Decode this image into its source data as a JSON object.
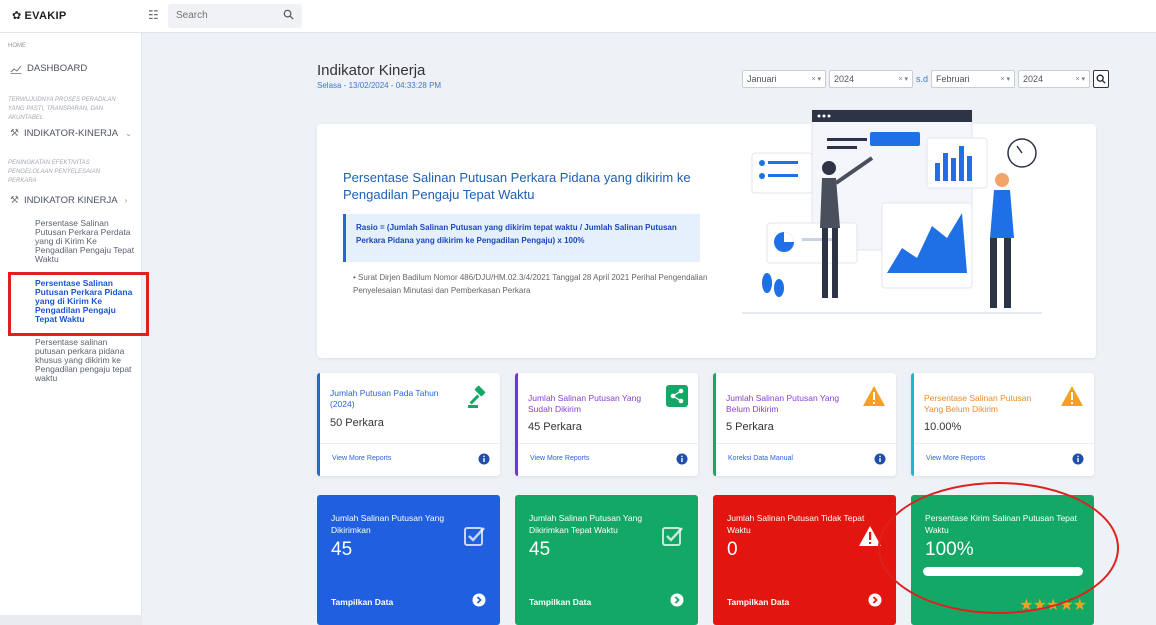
{
  "app": {
    "logo": "EVAKIP"
  },
  "search": {
    "placeholder": "Search"
  },
  "sidebar": {
    "home_label": "HOME",
    "dashboard": "DASHBOARD",
    "section1": "TERWUJUDNYA PROSES PERADILAN YANG PASTI, TRANSPARAN, DAN AKUNTABEL",
    "menu1": "INDIKATOR-KINERJA",
    "section2": "PENINGKATAN EFEKTIVITAS PENGELOLAAN PENYELESAIAN PERKARA",
    "menu2": "INDIKATOR KINERJA",
    "subitems": [
      "Persentase Salinan Putusan Perkara Perdata yang di Kirim Ke Pengadilan Pengaju Tepat Waktu",
      "Persentase Salinan Putusan Perkara Pidana yang di Kirim Ke Pengadilan Pengaju Tepat Waktu",
      "Persentase salinan putusan perkara pidana khusus yang dikirim ke Pengadilan pengaju tepat waktu"
    ]
  },
  "header": {
    "title": "Indikator Kinerja",
    "datetime": "Selasa - 13/02/2024 - 04:33:28 PM"
  },
  "filters": {
    "from_month": "Januari",
    "from_year": "2024",
    "separator": "s.d",
    "to_month": "Februari",
    "to_year": "2024"
  },
  "hero": {
    "title": "Persentase Salinan Putusan Perkara Pidana yang dikirim ke Pengadilan Pengaju Tepat Waktu",
    "ratio": "Rasio = (Jumlah Salinan Putusan yang dikirim tepat waktu / Jumlah Salinan Putusan Perkara Pidana yang dikirim ke Pengadilan Pengaju) x 100%",
    "note": "Surat Dirjen Badilum Nomor 486/DJU/HM.02.3/4/2021 Tanggal 28 April 2021 Perihal Pengendalian Penyelesaian Minutasi dan Pemberkasan Perkara"
  },
  "stat_cards": [
    {
      "title": "Jumlah Putusan Pada Tahun (2024)",
      "value": "50 Perkara",
      "link": "View More Reports",
      "accent": "#2b64d6",
      "title_color": "#2b64d6"
    },
    {
      "title": "Jumlah Salinan Putusan Yang Sudah Dikirim",
      "value": "45 Perkara",
      "link": "View More Reports",
      "accent": "#7b2fd6",
      "title_color": "#8a3fd1"
    },
    {
      "title": "Jumlah Salinan Putusan Yang Belum Dikirim",
      "value": "5 Perkara",
      "link": "Koreksi Data Manual",
      "accent": "#17a864",
      "title_color": "#8a3fd1"
    },
    {
      "title": "Persentase Salinan Putusan Yang Belum Dikirim",
      "value": "10.00%",
      "link": "View More Reports",
      "accent": "#19b9cf",
      "title_color": "#f08a24"
    }
  ],
  "color_cards": [
    {
      "title": "Jumlah Salinan Putusan Yang Dikirimkan",
      "value": "45",
      "footer": "Tampilkan Data",
      "bg": "#1f5fe0"
    },
    {
      "title": "Jumlah Salinan Putusan Yang Dikirimkan Tepat Waktu",
      "value": "45",
      "footer": "Tampilkan Data",
      "bg": "#13a866"
    },
    {
      "title": "Jumlah Salinan Putusan Tidak Tepat Waktu",
      "value": "0",
      "footer": "Tampilkan Data",
      "bg": "#e3150f"
    },
    {
      "title": "Persentase Kirim Salinan Putusan Tepat Waktu",
      "value": "100%",
      "progress": 1.0,
      "rating": 5,
      "bg": "#13a866"
    }
  ],
  "colors": {
    "primary": "#2b64d6",
    "green": "#13a866",
    "red": "#e3150f",
    "warning": "#f2a122",
    "highlight": "#e01f1f"
  }
}
